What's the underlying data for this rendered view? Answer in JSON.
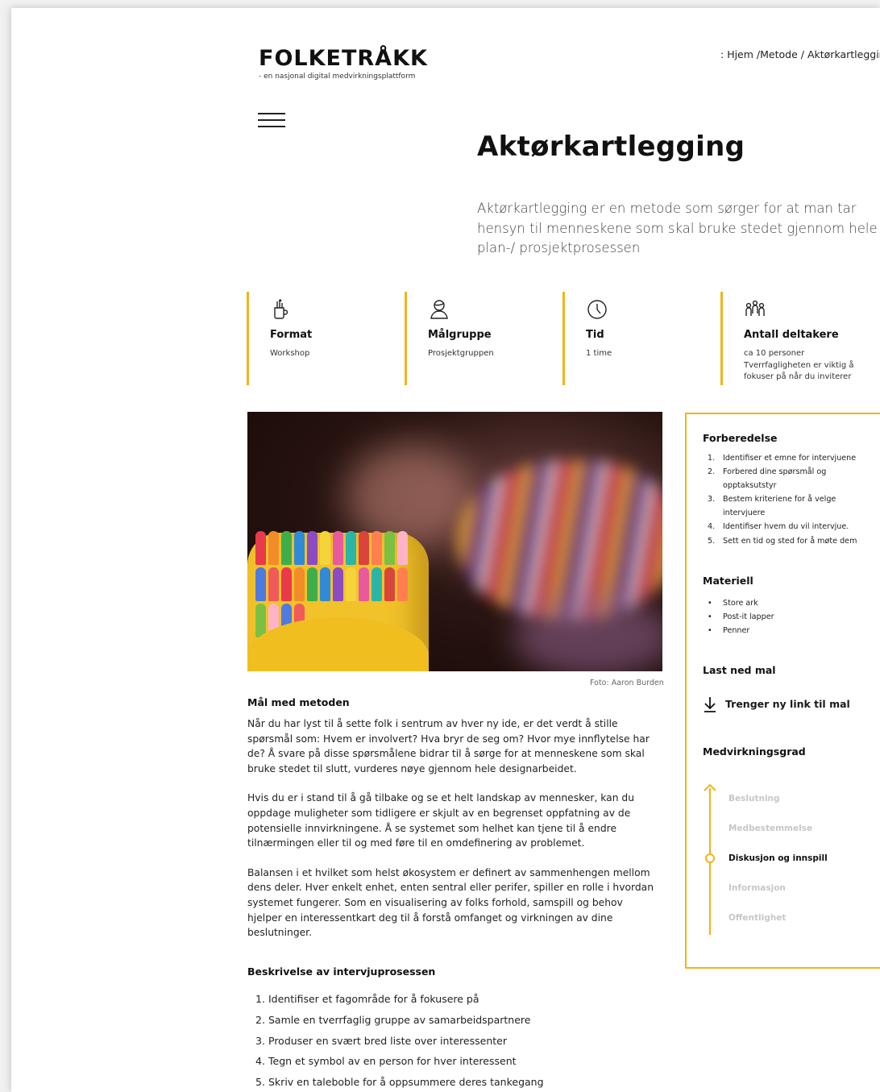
{
  "brand": {
    "name": "FOLKETRÅKK",
    "tagline": "- en nasjonal digital medvirkningsplattform"
  },
  "breadcrumb": {
    "prefix": ": ",
    "items": [
      "Hjem",
      "/Metode",
      "/ Aktørkartlegging"
    ]
  },
  "page": {
    "title": "Aktørkartlegging",
    "lead": "Aktørkartlegging er en metode som sørger for at man tar hensyn til menneskene som skal bruke stedet gjennom hele plan-/ prosjektprosessen"
  },
  "info_cards": [
    {
      "icon": "tools-cup-icon",
      "title": "Format",
      "value": "Workshop"
    },
    {
      "icon": "person-icon",
      "title": "Målgruppe",
      "value": "Prosjektgruppen"
    },
    {
      "icon": "clock-icon",
      "title": "Tid",
      "value": "1 time"
    },
    {
      "icon": "group-icon",
      "title": "Antall deltakere",
      "value": "ca 10 personer\nTverrfagligheten er viktig å fokuser på når du inviterer"
    }
  ],
  "photo": {
    "credit": "Foto: Aaron Burden"
  },
  "article": {
    "goal_heading": "Mål med metoden",
    "paragraphs": [
      "Når du har lyst til å sette folk i sentrum av hver ny ide, er det verdt å stille spørsmål som: Hvem er involvert? Hva bryr de seg om? Hvor mye innflytelse har de? Å svare på disse spørsmålene bidrar til å sørge for at menneskene som skal bruke stedet til slutt, vurderes nøye gjennom hele designarbeidet.",
      "Hvis du er i stand til å gå tilbake og se et helt landskap av mennesker, kan du oppdage muligheter som tidligere er skjult av en begrenset oppfatning av de potensielle innvirkningene. Å se systemet som helhet kan tjene til å endre tilnærmingen eller til og med føre til en omdefinering av problemet.",
      "Balansen i et hvilket som helst økosystem er definert av sammenhengen mellom dens deler. Hver enkelt enhet, enten sentral eller perifer, spiller en rolle i hvordan systemet fungerer. Som en visualisering av folks forhold, samspill og behov hjelper en interessentkart deg til å forstå omfanget og virkningen av dine beslutninger."
    ],
    "process_heading": "Beskrivelse av intervjuprosessen",
    "process_steps": [
      "Identifiser et fagområde for å fokusere på",
      "Samle en tverrfaglig gruppe av samarbeidspartnere",
      "Produser en svært bred liste over interessenter",
      "Tegn et symbol av en person for hver interessent",
      "Skriv en taleboble for å oppsummere deres tankegang"
    ]
  },
  "sidebar": {
    "prep_heading": "Forberedelse",
    "prep_steps": [
      "Identifiser et emne for intervjuene",
      "Forbered dine spørsmål og opptaksutstyr",
      "Bestem kriteriene for å velge intervjuere",
      "Identifiser hvem du vil intervjue.",
      "Sett en tid og sted for å møte dem"
    ],
    "material_heading": "Materiell",
    "materials": [
      "Store ark",
      "Post-it lapper",
      "Penner"
    ],
    "download_heading": "Last ned mal",
    "download_link": "Trenger ny link til mal",
    "degree_heading": "Medvirkningsgrad",
    "degree_levels": [
      "Beslutning",
      "Medbestemmelse",
      "Diskusjon og innspill",
      "Informasjon",
      "Offentlighet"
    ],
    "degree_active": "Diskusjon og innspill"
  },
  "colors": {
    "accent": "#f3b31c"
  }
}
